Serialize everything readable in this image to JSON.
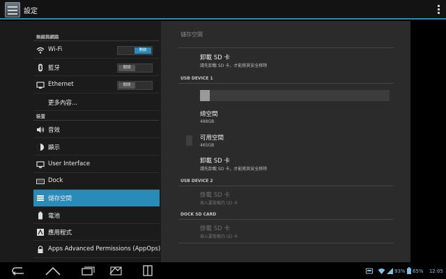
{
  "app": {
    "title": "設定"
  },
  "sidebar": {
    "headers": {
      "wireless": "無線與網路",
      "device": "裝置"
    },
    "items": [
      {
        "label": "Wi-Fi",
        "icon": "wifi-icon",
        "toggle": "開啟",
        "toggle_state": "on"
      },
      {
        "label": "藍牙",
        "icon": "bluetooth-icon",
        "toggle": "關閉",
        "toggle_state": "off"
      },
      {
        "label": "Ethernet",
        "icon": "ethernet-icon",
        "toggle": "關閉",
        "toggle_state": "off"
      },
      {
        "label": "更多內容..."
      },
      {
        "label": "音效",
        "icon": "sound-icon"
      },
      {
        "label": "顯示",
        "icon": "display-icon"
      },
      {
        "label": "User Interface",
        "icon": "monitor-icon"
      },
      {
        "label": "Dock",
        "icon": "keyboard-icon"
      },
      {
        "label": "儲存空間",
        "icon": "storage-icon",
        "selected": true
      },
      {
        "label": "電池",
        "icon": "battery-icon"
      },
      {
        "label": "應用程式",
        "icon": "apps-icon"
      },
      {
        "label": "Apps Advanced Permissions (AppOps)",
        "icon": "lock-icon"
      }
    ]
  },
  "storage": {
    "title": "儲存空間",
    "unmount1": {
      "title": "卸載 SD 卡",
      "sub": "請先卸載 SD 卡，才能將其安全移除"
    },
    "usb1": {
      "header": "USB DEVICE 1",
      "used_fraction": 0.05,
      "total": {
        "title": "總空間",
        "value": "488GB"
      },
      "available": {
        "title": "可用空間",
        "value": "465GB"
      },
      "unmount": {
        "title": "卸載 SD 卡",
        "sub": "請先卸載 SD 卡，才能將其安全移除"
      }
    },
    "usb2": {
      "header": "USB DEVICE 2",
      "mount": {
        "title": "掛載 SD 卡",
        "sub": "插入要掛載的 SD 卡"
      }
    },
    "dock": {
      "header": "DOCK SD CARD",
      "mount": {
        "title": "掛載 SD 卡",
        "sub": "插入要掛載的 SD 卡"
      }
    }
  },
  "status": {
    "wifi_pct": "93%",
    "battery_pct": "65%",
    "time": "12:05"
  },
  "colors": {
    "accent": "#2a8ab8",
    "status": "#7fc4e6"
  }
}
